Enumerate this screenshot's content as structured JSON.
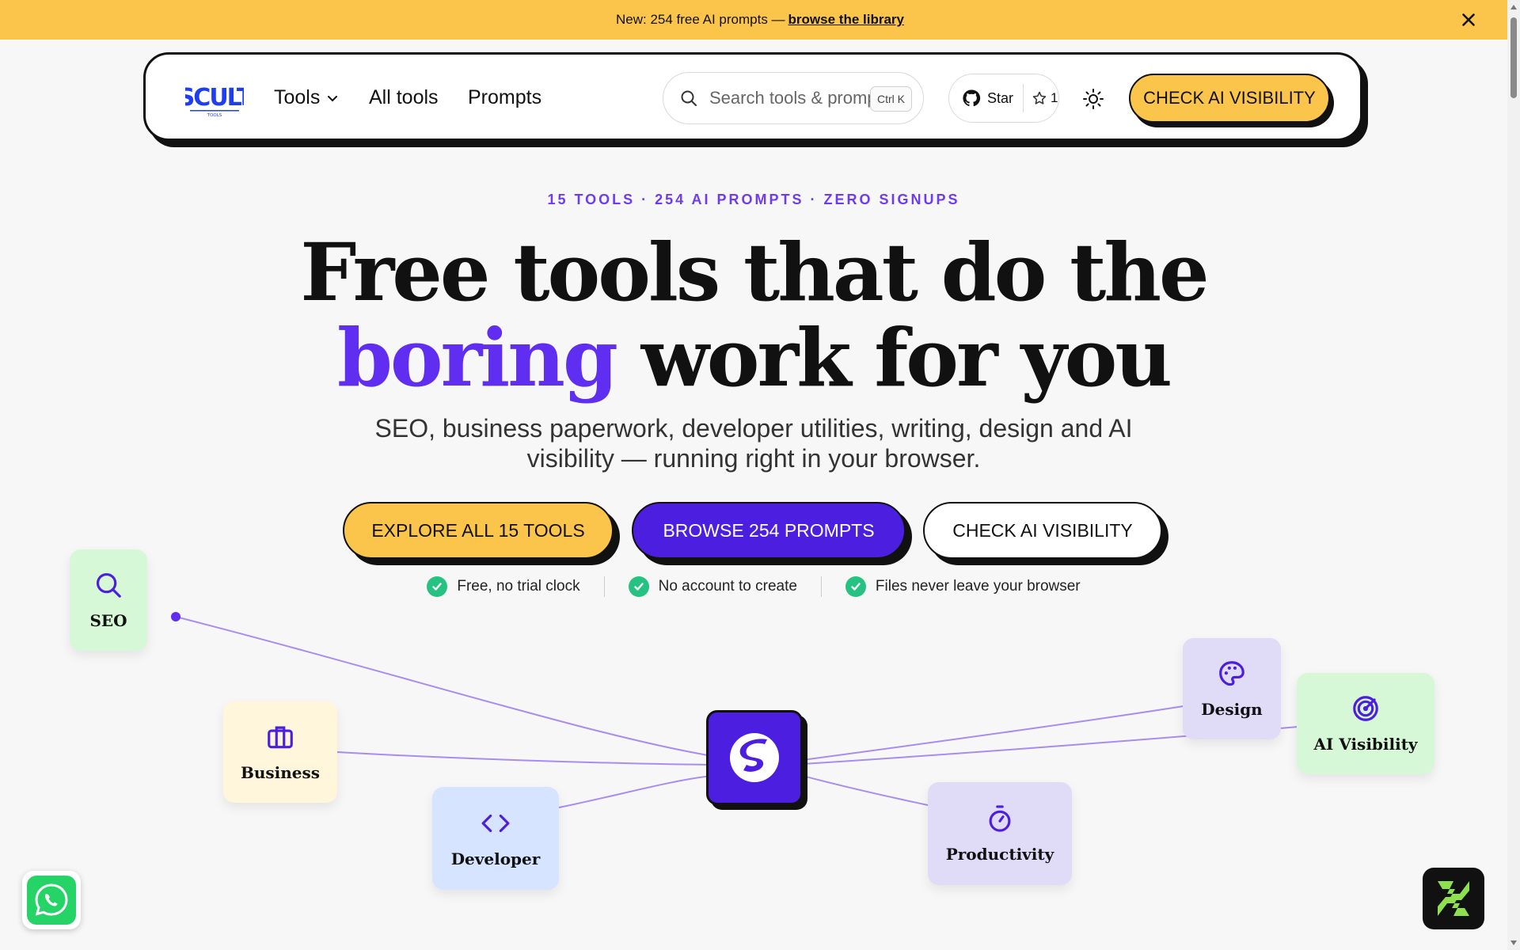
{
  "announcement": {
    "text": "New: 254 free AI prompts —",
    "link": "browse the library"
  },
  "nav": {
    "logo_alt": "SCULT TOOLS",
    "tools_label": "Tools",
    "all_tools_label": "All tools",
    "prompts_label": "Prompts",
    "search_placeholder": "Search tools & prompts",
    "search_shortcut": "Ctrl K",
    "github_label": "Star",
    "github_stars": "1",
    "cta_label": "CHECK AI VISIBILITY"
  },
  "hero": {
    "eyebrow": "15 TOOLS · 254 AI PROMPTS · ZERO SIGNUPS",
    "headline_line1": "Free tools that do the",
    "headline_accent": "boring",
    "headline_line2_rest": "work for you",
    "subheading": "SEO, business paperwork, developer utilities, writing, design and AI visibility — running right in your browser.",
    "buttons": {
      "explore": "EXPLORE ALL 15 TOOLS",
      "browse": "BROWSE 254 PROMPTS",
      "check": "CHECK AI VISIBILITY"
    },
    "features": [
      "Free, no trial clock",
      "No account to create",
      "Files never leave your browser"
    ]
  },
  "categories": {
    "seo": "SEO",
    "business": "Business",
    "developer": "Developer",
    "productivity": "Productivity",
    "design": "Design",
    "ai_visibility": "AI Visibility"
  },
  "colors": {
    "accent_yellow": "#fbc54c",
    "accent_purple": "#4c1fe0",
    "eyebrow_purple": "#6d3cf2",
    "check_green": "#26c281",
    "line_purple": "#a98bf2"
  }
}
